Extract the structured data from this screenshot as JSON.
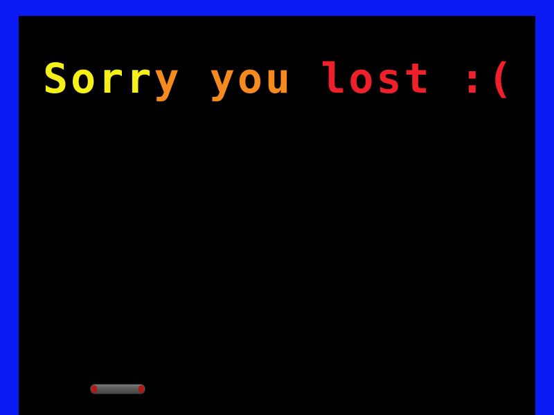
{
  "game": {
    "message": {
      "part1": "Sorr",
      "part2": "y you ",
      "part3": "lost :("
    }
  },
  "colors": {
    "wall": "#0a1af5",
    "background": "#000000",
    "text_yellow": "#f5f018",
    "text_orange": "#f58a1e",
    "text_red": "#f0202a",
    "paddle_body": "#5a5a5a",
    "paddle_caps": "#b31818"
  }
}
